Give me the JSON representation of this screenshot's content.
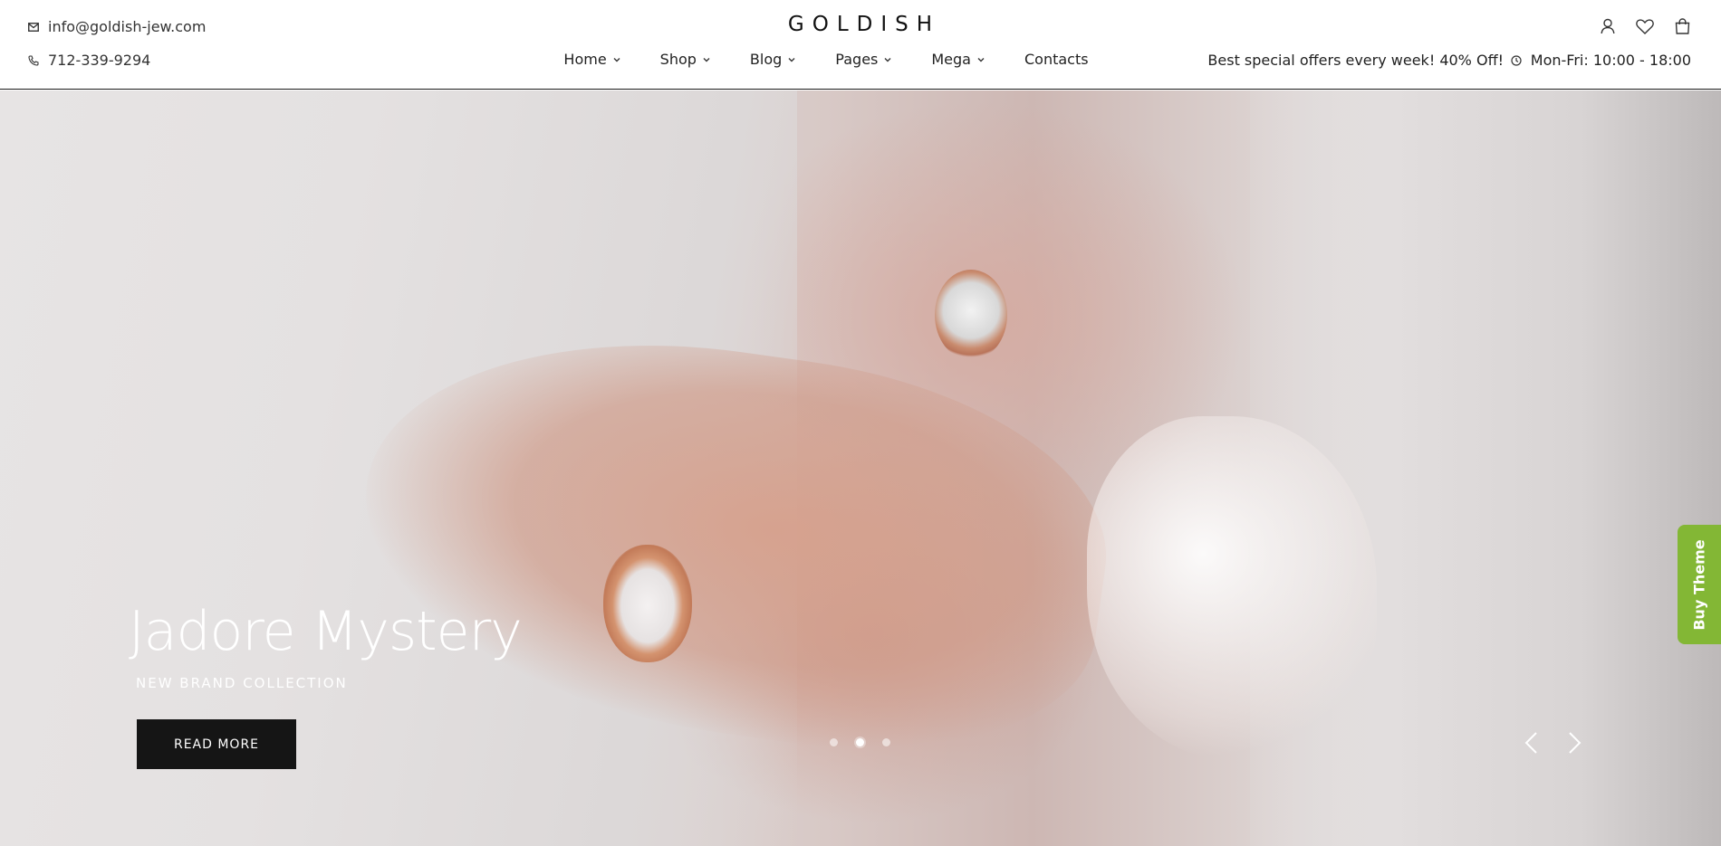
{
  "header": {
    "email": "info@goldish-jew.com",
    "phone": "712-339-9294",
    "logo": "GOLDISH",
    "promo": "Best special offers every week! 40% Off!",
    "hours": "Mon-Fri: 10:00 - 18:00",
    "icons": [
      "user-icon",
      "heart-icon",
      "bag-icon"
    ]
  },
  "nav": {
    "items": [
      {
        "label": "Home",
        "dropdown": true
      },
      {
        "label": "Shop",
        "dropdown": true
      },
      {
        "label": "Blog",
        "dropdown": true
      },
      {
        "label": "Pages",
        "dropdown": true
      },
      {
        "label": "Mega",
        "dropdown": true
      },
      {
        "label": "Contacts",
        "dropdown": false
      }
    ]
  },
  "hero": {
    "title": "Jadore Mystery",
    "subtitle": "NEW BRAND COLLECTION",
    "button": "READ MORE",
    "slides": 3,
    "active_slide": 2
  },
  "side_tab": {
    "label": "Buy Theme",
    "color": "#83b735"
  }
}
